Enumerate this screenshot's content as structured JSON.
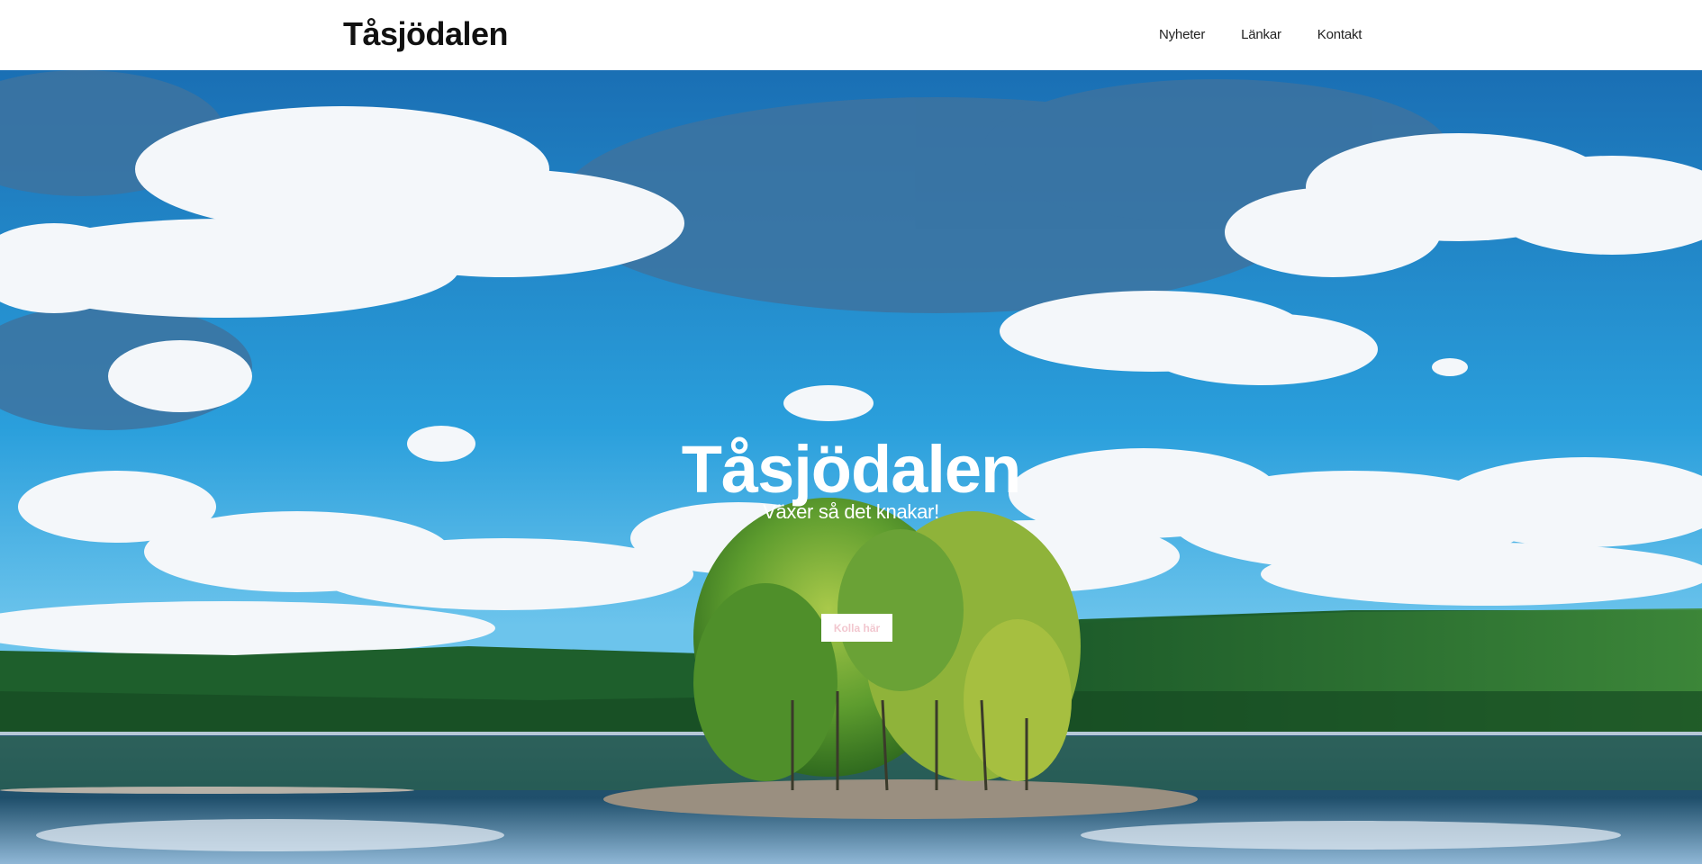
{
  "header": {
    "brand": "Tåsjödalen",
    "nav": [
      {
        "label": "Nyheter"
      },
      {
        "label": "Länkar"
      },
      {
        "label": "Kontakt"
      }
    ]
  },
  "hero": {
    "title": "Tåsjödalen",
    "subtitle": "Växer så det knakar!",
    "button_label": "Kolla här",
    "background_image": "lake-with-tree-island-and-cloudy-sky",
    "colors": {
      "sky": "#1f8fd0",
      "cloud": "#f4f7fa",
      "forest": "#1e5f2c",
      "water": "#2a5f8a",
      "button_text": "#f2c7cf"
    }
  }
}
